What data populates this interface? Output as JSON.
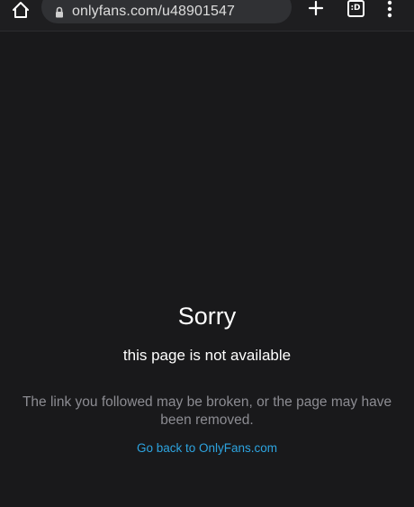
{
  "browser": {
    "url": "onlyfans.com/u48901547",
    "tabs_label": ":D",
    "icons": {
      "home": "home-icon",
      "lock": "lock-icon",
      "new_tab": "plus-icon",
      "tabs": "tab-switcher-icon",
      "menu": "more-vert-icon"
    }
  },
  "page": {
    "title": "Sorry",
    "subtitle": "this page is not available",
    "message": "The link you followed may be broken, or the page may have been removed.",
    "link_label": "Go back to OnlyFans.com"
  },
  "colors": {
    "background": "#19191b",
    "toolbar": "#1e1e20",
    "url_bar": "#303134",
    "muted_text": "#8c8c92",
    "link": "#2da4e0"
  }
}
